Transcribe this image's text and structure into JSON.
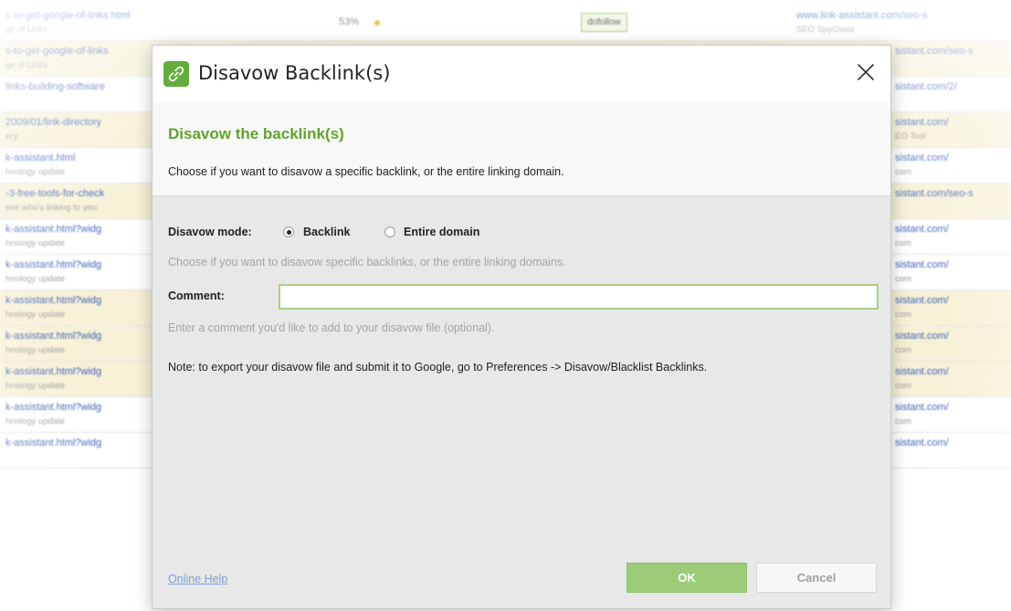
{
  "background_table": {
    "rows": [
      {
        "link": "s-to-get-google-of-links.html",
        "sub": "ge of Links",
        "pct": "53%",
        "tag": "dofollow",
        "url": "www.link-assistant.com/seo-s",
        "url_sub": "SEO SpyGlass",
        "highlight": false
      },
      {
        "link": "s-to-get-google-of-links",
        "sub": "ge of Links",
        "url": "sistant.com/seo-s",
        "url_sub": "",
        "highlight": true
      },
      {
        "link": "links-building-software",
        "sub": "",
        "url": "sistant.com/2/",
        "url_sub": "",
        "highlight": false
      },
      {
        "link": "2009/01/link-directory",
        "sub": "ery",
        "url": "sistant.com/",
        "url_sub": "EO Tool",
        "highlight": true
      },
      {
        "link": "k-assistant.html",
        "sub": "hnology update",
        "url": "sistant.com/",
        "url_sub": "com",
        "highlight": false
      },
      {
        "link": "-3-free-tools-for-check",
        "sub": "see who's linking to you",
        "url": "sistant.com/seo-s",
        "url_sub": "",
        "highlight": true
      },
      {
        "link": "k-assistant.html?widg",
        "sub": "hnology update",
        "url": "sistant.com/",
        "url_sub": "com",
        "highlight": false
      },
      {
        "link": "k-assistant.html?widg",
        "sub": "hnology update",
        "url": "sistant.com/",
        "url_sub": "com",
        "highlight": false
      },
      {
        "link": "k-assistant.html?widg",
        "sub": "hnology update",
        "url": "sistant.com/",
        "url_sub": "com",
        "highlight": true
      },
      {
        "link": "k-assistant.html?widg",
        "sub": "hnology update",
        "url": "sistant.com/",
        "url_sub": "com",
        "highlight": true
      },
      {
        "link": "k-assistant.html?widg",
        "sub": "hnology update",
        "url": "sistant.com/",
        "url_sub": "com",
        "highlight": true
      },
      {
        "link": "k-assistant.html?widg",
        "sub": "hnology update",
        "url": "sistant.com/",
        "url_sub": "com",
        "highlight": false
      },
      {
        "link": "k-assistant.html?widg",
        "sub": "",
        "url": "sistant.com/",
        "url_sub": "",
        "highlight": false
      }
    ]
  },
  "dialog": {
    "title": "Disavow Backlink(s)",
    "app_icon": "link-icon",
    "close_icon": "close-icon",
    "heading": "Disavow the backlink(s)",
    "description": "Choose if you want to disavow a specific backlink, or the entire linking domain.",
    "mode_label": "Disavow mode:",
    "mode_options": [
      {
        "label": "Backlink",
        "checked": true
      },
      {
        "label": "Entire domain",
        "checked": false
      }
    ],
    "mode_help": "Choose if you want to disavow specific backlinks, or the entire linking domains.",
    "comment_label": "Comment:",
    "comment_value": "",
    "comment_help": "Enter a comment you'd like to add to your disavow file (optional).",
    "note": "Note: to export your disavow file and submit it to Google, go to Preferences -> Disavow/Blacklist Backlinks.",
    "online_help": "Online Help",
    "ok_label": "OK",
    "cancel_label": "Cancel"
  },
  "colors": {
    "accent_green": "#5da52b",
    "ok_button": "#9ccc78",
    "input_border": "#a9cf86",
    "row_highlight": "#f6f1d6"
  }
}
